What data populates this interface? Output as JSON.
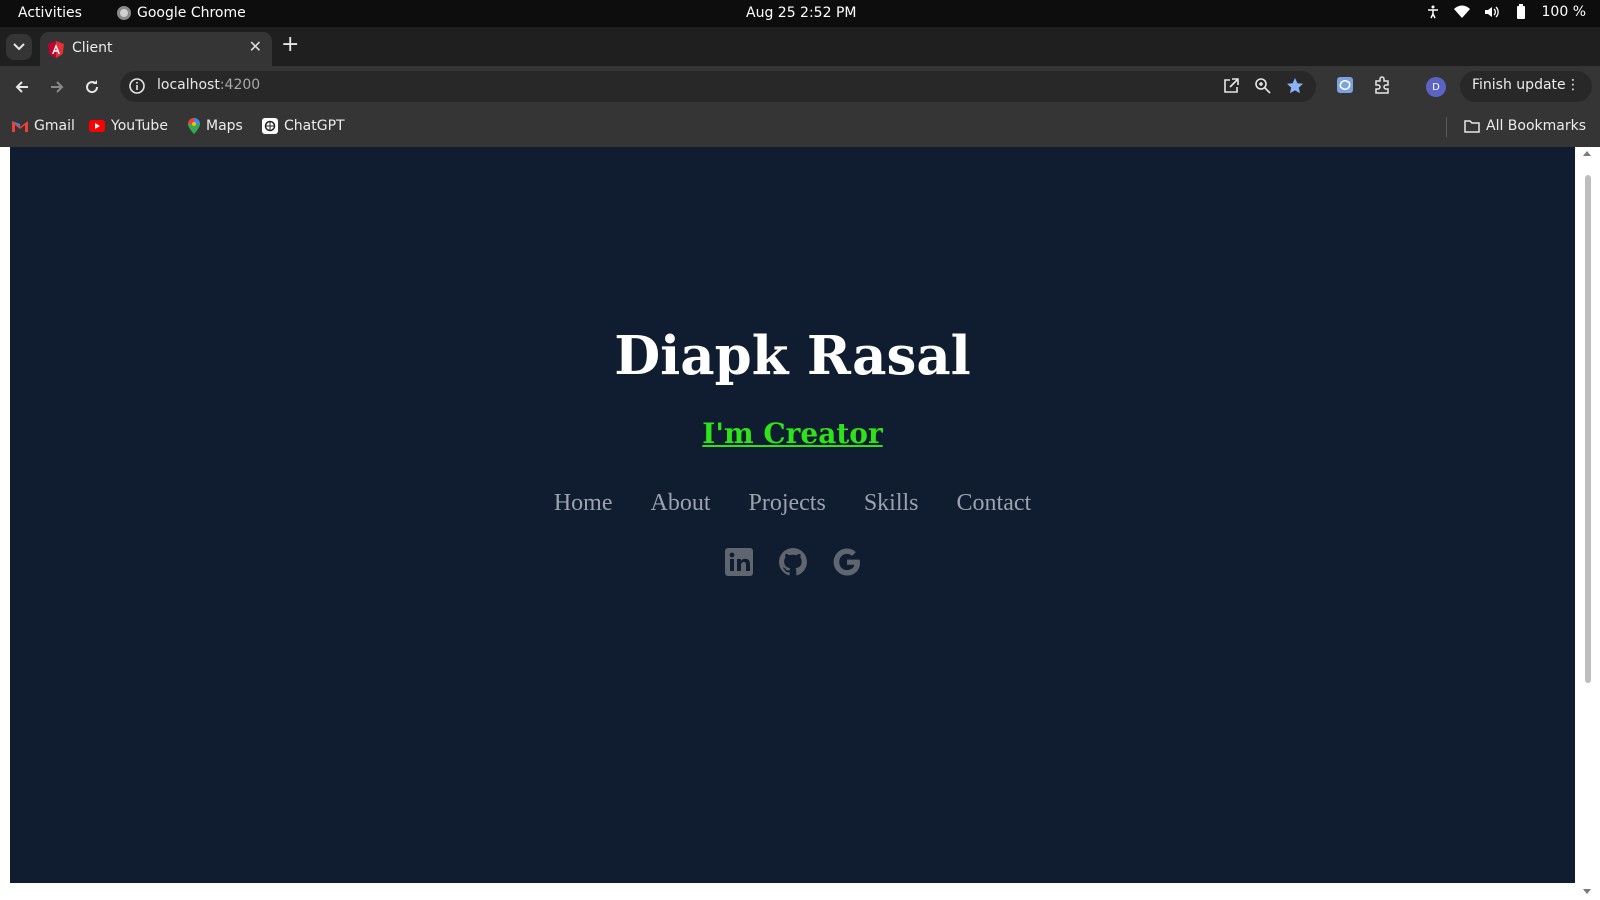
{
  "system_bar": {
    "activities": "Activities",
    "app_name": "Google Chrome",
    "datetime": "Aug 25  2:52 PM",
    "battery": "100 %"
  },
  "browser": {
    "tab_title": "Client",
    "url_host": "localhost",
    "url_port": ":4200",
    "finish_update": "Finish update",
    "avatar_initial": "D",
    "bookmarks": [
      {
        "label": "Gmail",
        "icon": "gmail-icon"
      },
      {
        "label": "YouTube",
        "icon": "youtube-icon"
      },
      {
        "label": "Maps",
        "icon": "maps-icon"
      },
      {
        "label": "ChatGPT",
        "icon": "chatgpt-icon"
      }
    ],
    "all_bookmarks": "All Bookmarks"
  },
  "page": {
    "name": "Diapk Rasal",
    "role": "I'm Creator",
    "nav": [
      "Home",
      "About",
      "Projects",
      "Skills",
      "Contact"
    ],
    "socials": [
      "linkedin-icon",
      "github-icon",
      "google-icon"
    ],
    "colors": {
      "background": "#101d31",
      "accent": "#2ee31a",
      "nav_text": "#9aa2ad",
      "social_icon": "#5f6670"
    }
  }
}
